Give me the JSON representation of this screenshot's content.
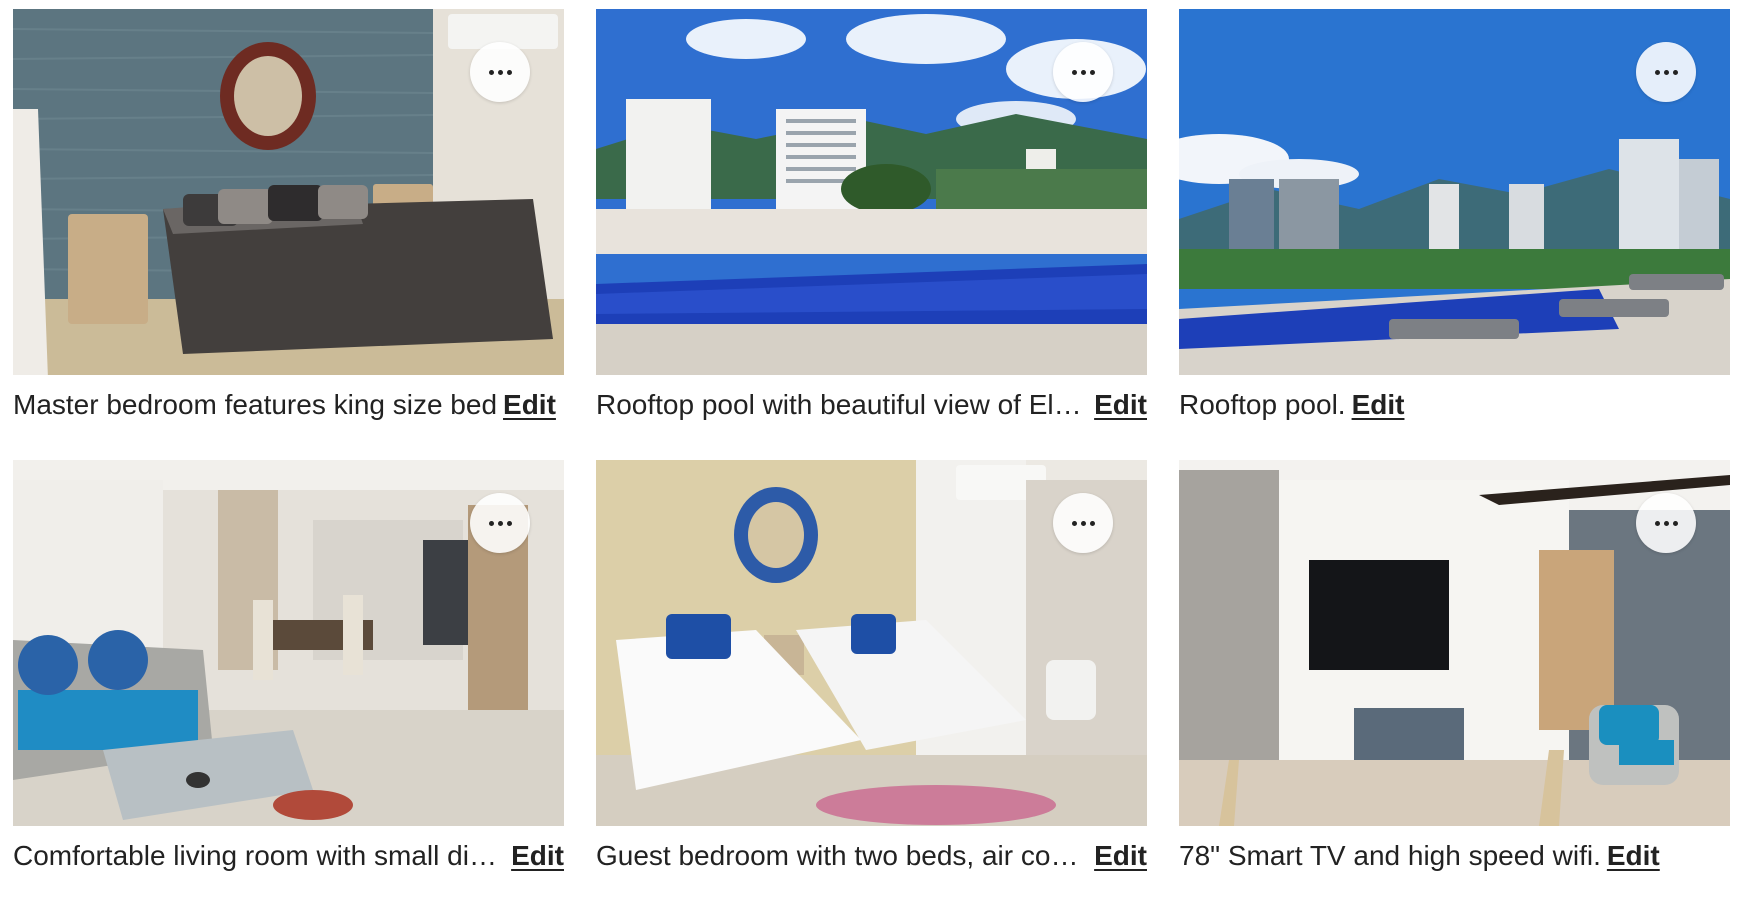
{
  "photos": [
    {
      "caption": "Master bedroom features king size bed",
      "edit_label": "Edit",
      "more_icon": "ellipsis-icon"
    },
    {
      "caption": "Rooftop pool with beautiful view of El Rodadero",
      "edit_label": "Edit",
      "more_icon": "ellipsis-icon"
    },
    {
      "caption": "Rooftop pool.",
      "edit_label": "Edit",
      "more_icon": "ellipsis-icon"
    },
    {
      "caption": "Comfortable living room with small dining area",
      "edit_label": "Edit",
      "more_icon": "ellipsis-icon"
    },
    {
      "caption": "Guest bedroom with two beds, air conditioning",
      "edit_label": "Edit",
      "more_icon": "ellipsis-icon"
    },
    {
      "caption": "78\" Smart TV and high speed wifi.",
      "edit_label": "Edit",
      "more_icon": "ellipsis-icon"
    }
  ]
}
